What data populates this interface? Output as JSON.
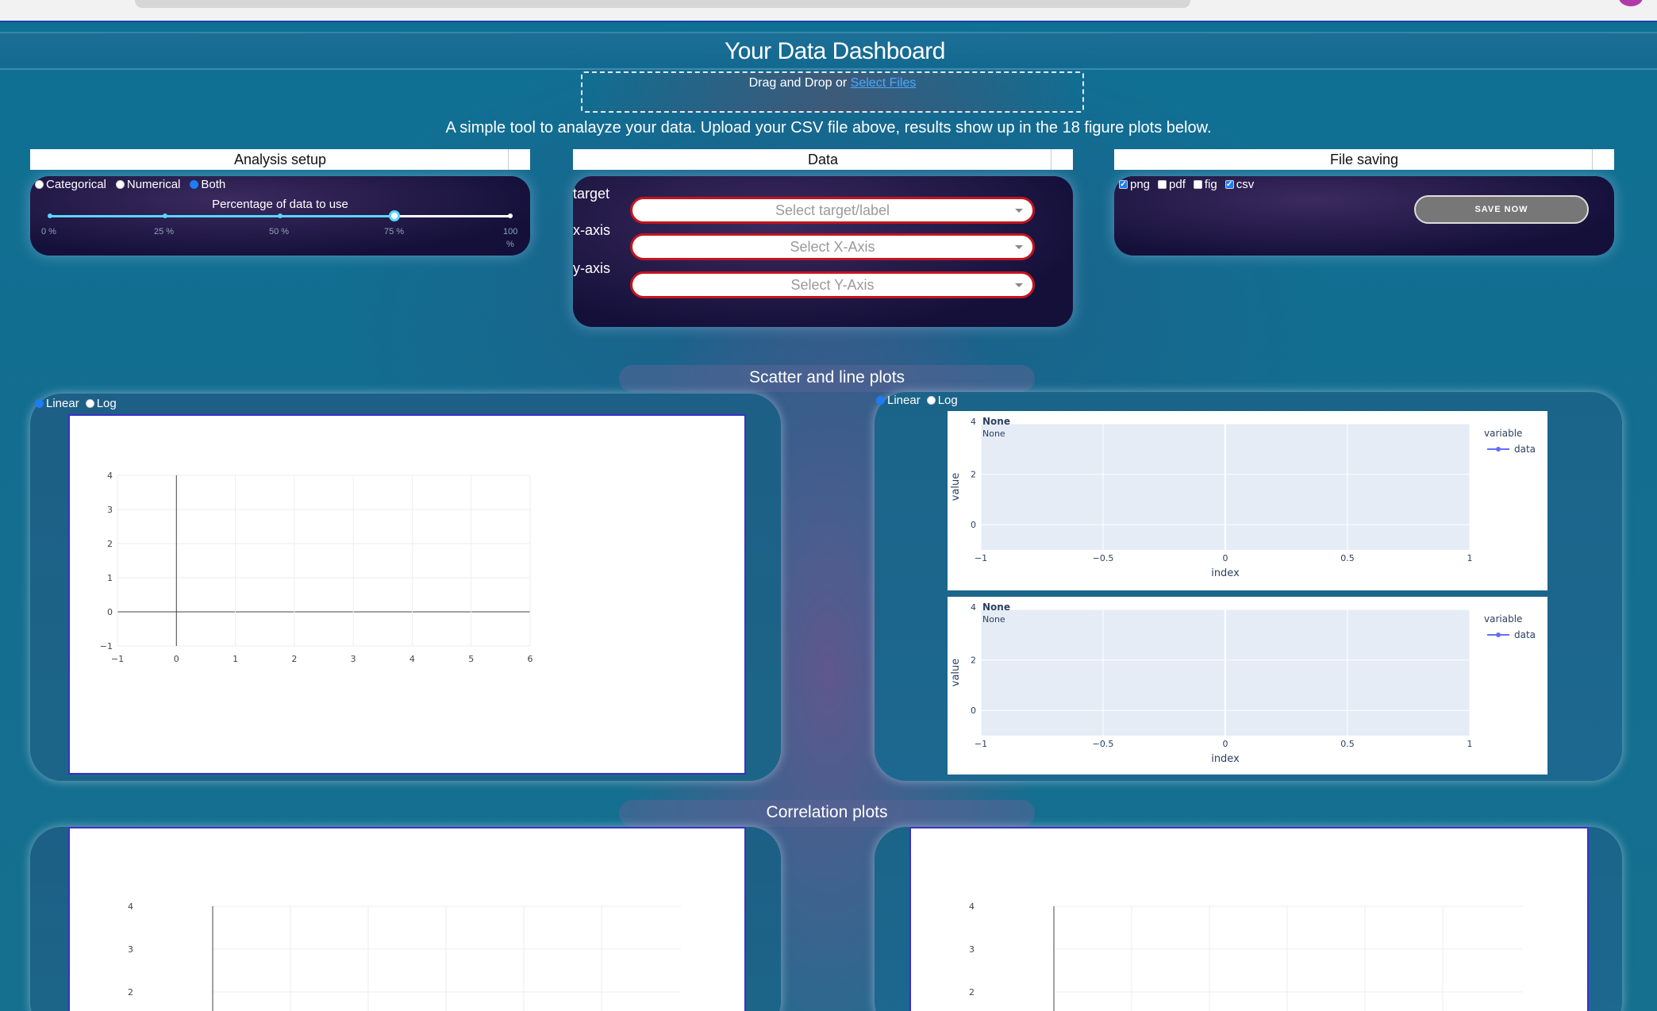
{
  "header": {
    "title": "Your Data Dashboard",
    "upload_text": "Drag and Drop or ",
    "upload_link": "Select Files",
    "subtitle": "A simple tool to analayze your data. Upload your CSV file above, results show up in the 18 figure plots below."
  },
  "analysis": {
    "title": "Analysis setup",
    "types": [
      {
        "label": "Categorical",
        "selected": false
      },
      {
        "label": "Numerical",
        "selected": false
      },
      {
        "label": "Both",
        "selected": true
      }
    ],
    "slider_label": "Percentage of data to use",
    "slider_value_percent": 75,
    "slider_ticks": [
      "0 %",
      "25 %",
      "50 %",
      "75 %",
      "100",
      "%"
    ]
  },
  "data_panel": {
    "title": "Data",
    "target_label": "target",
    "target_placeholder": "Select target/label",
    "xaxis_label": "x-axis",
    "xaxis_placeholder": "Select X-Axis",
    "yaxis_label": "y-axis",
    "yaxis_placeholder": "Select Y-Axis"
  },
  "file_saving": {
    "title": "File saving",
    "formats": [
      {
        "label": "png",
        "checked": true
      },
      {
        "label": "pdf",
        "checked": false
      },
      {
        "label": "fig",
        "checked": false
      },
      {
        "label": "csv",
        "checked": true
      }
    ],
    "save_label": "SAVE NOW"
  },
  "sections": {
    "scatter": "Scatter and line plots",
    "correlation": "Correlation plots"
  },
  "scale_options": [
    {
      "label": "Linear",
      "selected": true
    },
    {
      "label": "Log",
      "selected": false
    }
  ],
  "plotly": {
    "title_bold": "None",
    "title_sub": "None",
    "legend_title": "variable",
    "legend_item": "data",
    "xlabel": "index",
    "ylabel": "value"
  },
  "colors": {
    "accent": "#1f7cf2",
    "slider": "#5bd6ff",
    "select_border": "#c4141e",
    "plot_bg": "#e5ecf6",
    "trace": "#636efa"
  },
  "chart_data": [
    {
      "type": "scatter",
      "title": "",
      "x": [],
      "y": [],
      "xlim": [
        -1,
        6
      ],
      "ylim": [
        -1,
        4
      ],
      "xticks": [
        "−1",
        "0",
        "1",
        "2",
        "3",
        "4",
        "5",
        "6"
      ],
      "yticks": [
        "−1",
        "0",
        "1",
        "2",
        "3",
        "4"
      ],
      "grid": true
    },
    {
      "type": "line",
      "title": "None",
      "subtitle": "None",
      "xlabel": "index",
      "ylabel": "value",
      "series": [
        {
          "name": "data",
          "values": []
        }
      ],
      "legend_title": "variable",
      "xlim": [
        -1,
        1
      ],
      "ylim": [
        -1,
        4
      ],
      "xticks": [
        "−1",
        "−0.5",
        "0",
        "0.5",
        "1"
      ],
      "yticks": [
        "0",
        "2",
        "4"
      ],
      "legend": "top-right"
    },
    {
      "type": "line",
      "title": "None",
      "subtitle": "None",
      "xlabel": "index",
      "ylabel": "value",
      "series": [
        {
          "name": "data",
          "values": []
        }
      ],
      "legend_title": "variable",
      "xlim": [
        -1,
        1
      ],
      "ylim": [
        -1,
        4
      ],
      "xticks": [
        "−1",
        "−0.5",
        "0",
        "0.5",
        "1"
      ],
      "yticks": [
        "0",
        "2",
        "4"
      ],
      "legend": "top-right"
    },
    {
      "type": "scatter",
      "title": "",
      "x": [],
      "y": [],
      "ylim": [
        -1,
        4
      ],
      "yticks": [
        "2",
        "3",
        "4"
      ],
      "grid": true
    },
    {
      "type": "scatter",
      "title": "",
      "x": [],
      "y": [],
      "ylim": [
        -1,
        4
      ],
      "yticks": [
        "2",
        "3",
        "4"
      ],
      "grid": true
    }
  ]
}
